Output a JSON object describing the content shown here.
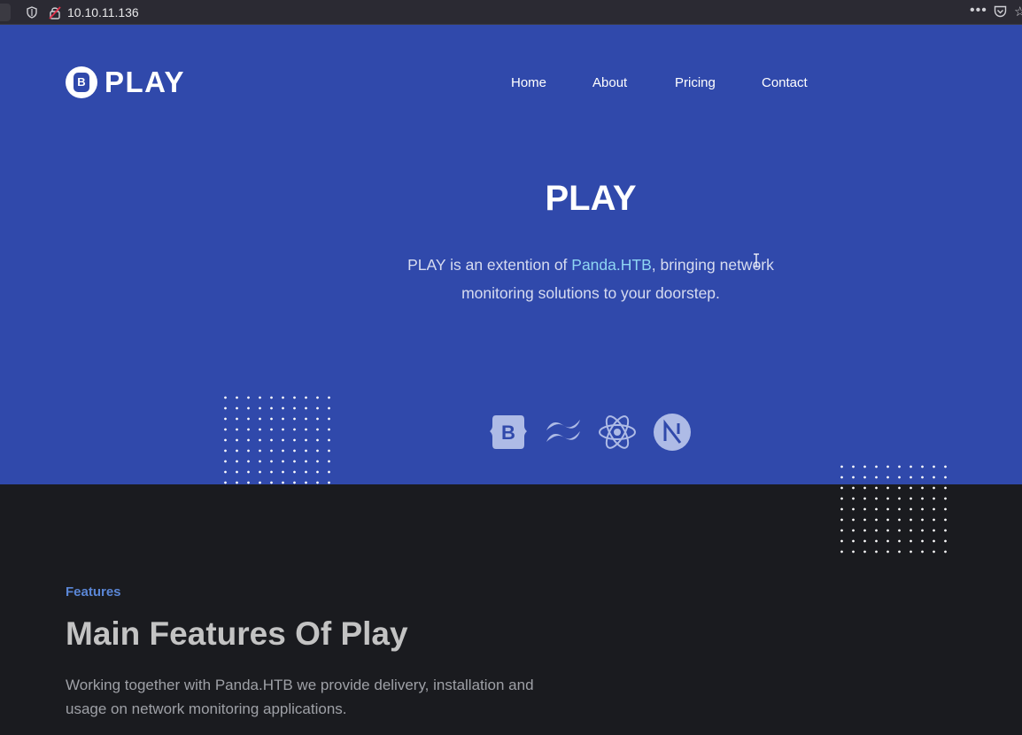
{
  "browser": {
    "url": "10.10.11.136",
    "menu_icon": "more-dots-icon"
  },
  "header": {
    "logo_letter": "B",
    "logo_text": "PLAY",
    "nav": [
      "Home",
      "About",
      "Pricing",
      "Contact"
    ]
  },
  "hero": {
    "title": "PLAY",
    "text_before": "PLAY is an extention of ",
    "link": "Panda.HTB",
    "text_after": ", bringing network monitoring solutions to your doorstep.",
    "tech_icons": [
      "bootstrap-icon",
      "tailwind-icon",
      "react-icon",
      "nextjs-icon"
    ]
  },
  "features": {
    "kicker": "Features",
    "title": "Main Features Of Play",
    "text": "Working together with Panda.HTB we provide delivery, installation and usage on network monitoring applications."
  },
  "colors": {
    "hero_bg": "#3049ab",
    "page_bg": "#1a1b1f",
    "link": "#8fd6f3",
    "kicker": "#5a86d6"
  }
}
